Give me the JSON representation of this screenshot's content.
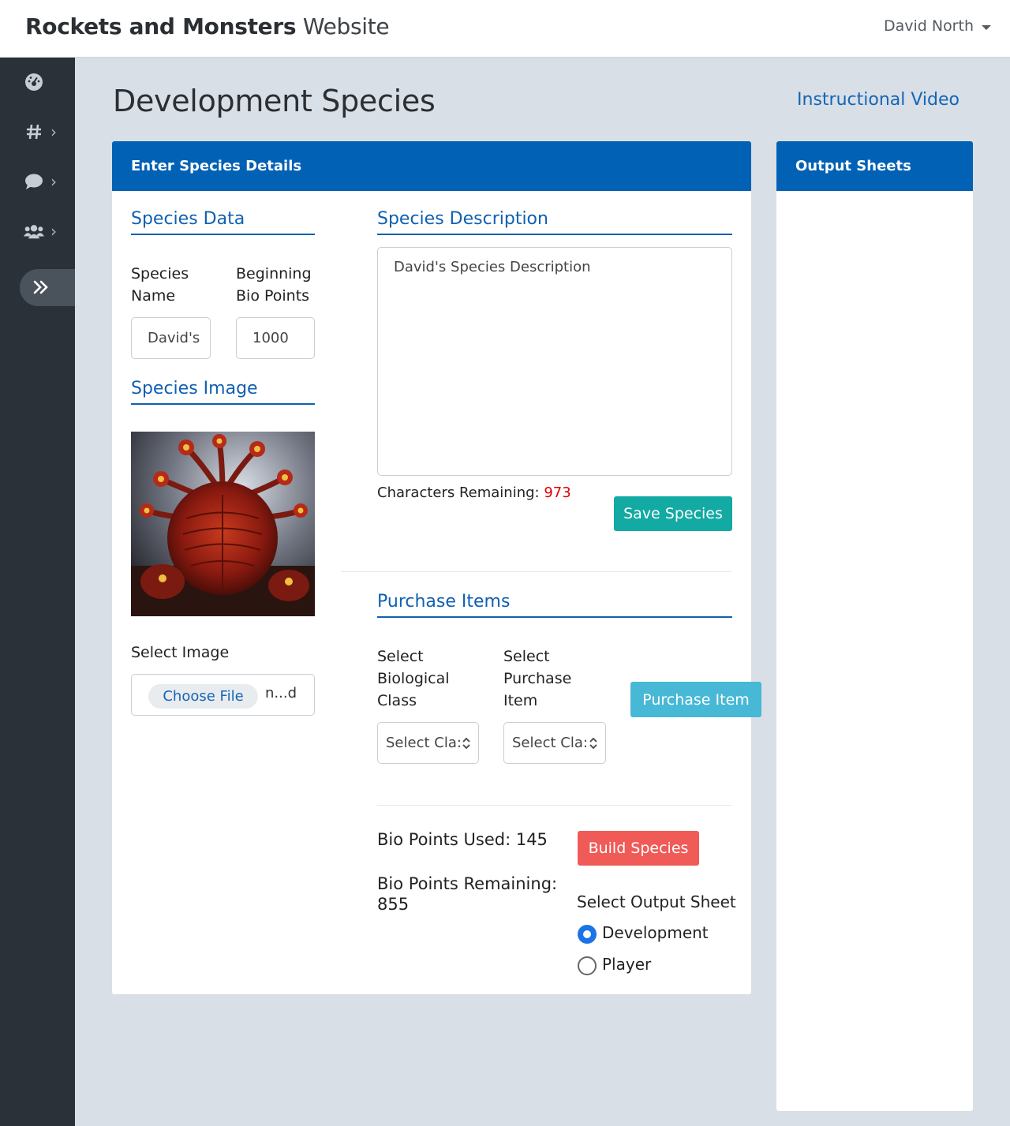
{
  "header": {
    "brand_bold": "Rockets and Monsters",
    "brand_light": "Website",
    "user_name": "David North"
  },
  "sidebar": {
    "items": [
      {
        "icon": "dashboard-icon"
      },
      {
        "icon": "hashtag-icon"
      },
      {
        "icon": "chat-bubble-icon"
      },
      {
        "icon": "users-icon"
      },
      {
        "icon": "double-chevron-right-icon",
        "active": true
      }
    ]
  },
  "page": {
    "title": "Development Species",
    "instructional_link": "Instructional Video"
  },
  "species_card": {
    "header": "Enter Species Details",
    "species_data_title": "Species Data",
    "species_name_label": "Species Name",
    "species_name_value": "David's",
    "bio_points_label": "Beginning Bio Points",
    "bio_points_value": "1000",
    "species_image_title": "Species Image",
    "select_image_label": "Select Image",
    "choose_file_label": "Choose File",
    "file_name": "n...d",
    "description_title": "Species Description",
    "description_value": "David's Species Description",
    "chars_remaining_label": "Characters Remaining:",
    "chars_remaining_value": "973",
    "save_button": "Save Species",
    "purchase_title": "Purchase Items",
    "select_bio_class_label": "Select Biological Class",
    "select_bio_class_value": "Select Cla:",
    "select_purchase_item_label": "Select Purchase Item",
    "select_purchase_item_value": "Select Cla:",
    "purchase_button": "Purchase Item",
    "bio_points_used_label": "Bio Points Used: 145",
    "bio_points_remaining_label": "Bio Points Remaining:",
    "bio_points_remaining_value": "855",
    "build_button": "Build Species",
    "output_sheet_label": "Select Output Sheet",
    "output_options": [
      "Development",
      "Player"
    ],
    "selected_output": "Development"
  },
  "output_card": {
    "header": "Output Sheets"
  },
  "colors": {
    "primary": "#0061b5",
    "link": "#1565b5",
    "teal": "#12aaa2",
    "cyan": "#47b8d6",
    "danger": "#f05a57",
    "remaining": "#e00000"
  }
}
